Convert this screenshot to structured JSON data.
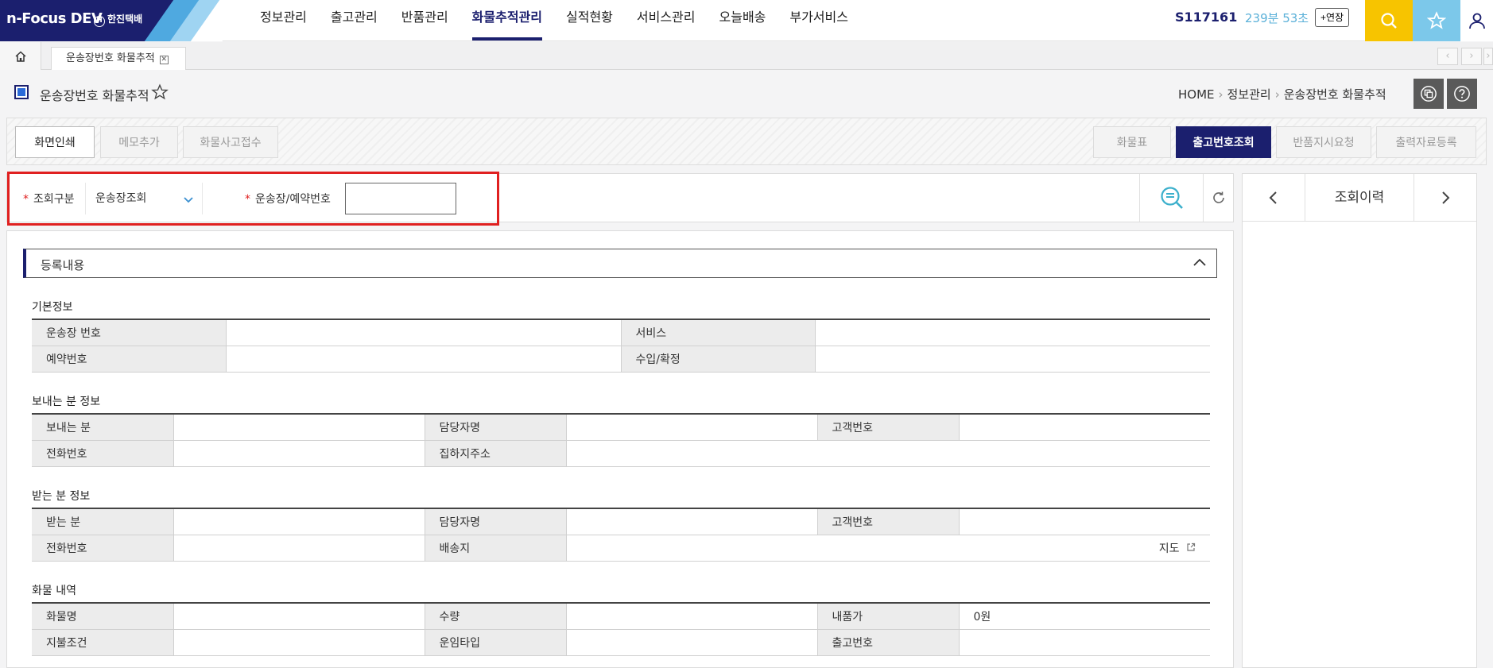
{
  "app": {
    "logo": "n-Focus DEV",
    "company": "한진택배"
  },
  "nav": {
    "items": [
      "정보관리",
      "출고관리",
      "반품관리",
      "화물추적관리",
      "실적현황",
      "서비스관리",
      "오늘배송",
      "부가서비스"
    ],
    "active_index": 3
  },
  "session": {
    "user_id": "S117161",
    "timer": "239분 53초",
    "extend_label": "+연장"
  },
  "tabs": {
    "open_tab": "운송장번호 화물추적"
  },
  "page": {
    "title": "운송장번호 화물추적",
    "breadcrumb": [
      "HOME",
      "정보관리",
      "운송장번호 화물추적"
    ]
  },
  "actions": {
    "left": [
      "화면인쇄",
      "메모추가",
      "화물사고접수"
    ],
    "right": [
      "화물표",
      "출고번호조회",
      "반품지시요청",
      "출력자료등록"
    ]
  },
  "search": {
    "type_label": "조회구분",
    "type_value": "운송장조회",
    "number_label": "운송장/예약번호",
    "number_value": ""
  },
  "history": {
    "title": "조회이력"
  },
  "section": {
    "title": "등록내용"
  },
  "basic": {
    "title": "기본정보",
    "waybill_label": "운송장 번호",
    "waybill_value": "",
    "service_label": "서비스",
    "service_value": "",
    "reservation_label": "예약번호",
    "reservation_value": "",
    "confirm_label": "수입/확정",
    "confirm_value": ""
  },
  "sender": {
    "title": "보내는 분 정보",
    "name_label": "보내는 분",
    "manager_label": "담당자명",
    "customer_no_label": "고객번호",
    "phone_label": "전화번호",
    "address_label": "집하지주소"
  },
  "receiver": {
    "title": "받는 분 정보",
    "name_label": "받는 분",
    "manager_label": "담당자명",
    "customer_no_label": "고객번호",
    "phone_label": "전화번호",
    "address_label": "배송지",
    "map_label": "지도"
  },
  "cargo": {
    "title": "화물 내역",
    "name_label": "화물명",
    "qty_label": "수량",
    "price_label": "내품가",
    "price_value": "0원",
    "payment_label": "지불조건",
    "fare_label": "운임타입",
    "release_no_label": "출고번호"
  },
  "colors": {
    "brand": "#1b1f6e",
    "highlight": "#e02020",
    "search_btn": "#f7c400",
    "fav_btn": "#7cc8ea"
  }
}
